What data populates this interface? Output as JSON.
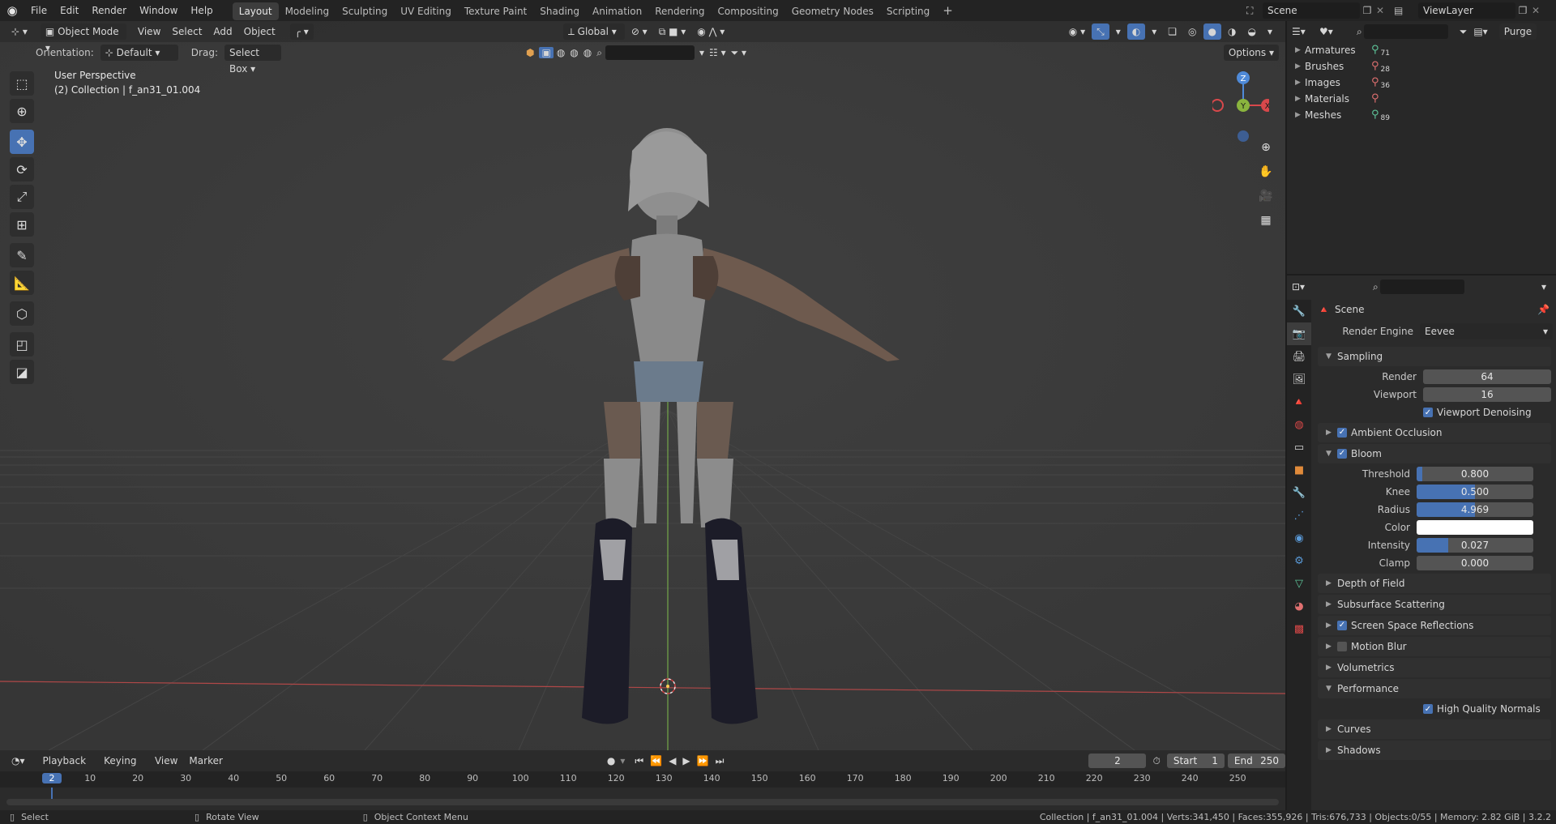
{
  "topbar": {
    "menus": [
      "File",
      "Edit",
      "Render",
      "Window",
      "Help"
    ],
    "workspaces": [
      "Layout",
      "Modeling",
      "Sculpting",
      "UV Editing",
      "Texture Paint",
      "Shading",
      "Animation",
      "Rendering",
      "Compositing",
      "Geometry Nodes",
      "Scripting"
    ],
    "active_workspace": "Layout",
    "add_tab": "+",
    "scene_name": "Scene",
    "view_layer": "ViewLayer"
  },
  "viewport": {
    "mode": "Object Mode",
    "menus": [
      "View",
      "Select",
      "Add",
      "Object"
    ],
    "transform_orientation": "Global",
    "orientation_label": "Orientation:",
    "orientation_value": "Default",
    "drag_label": "Drag:",
    "drag_value": "Select Box",
    "options_label": "Options",
    "perspective_text": "User Perspective",
    "collection_text": "(2) Collection | f_an31_01.004",
    "gizmo_labels": {
      "z": "Z",
      "y": "Y",
      "x": "X"
    }
  },
  "outliner": {
    "purge_label": "Purge",
    "items": [
      {
        "name": "Armatures",
        "count": "71",
        "color": "#5ec59a"
      },
      {
        "name": "Brushes",
        "count": "28",
        "color": "#e07070"
      },
      {
        "name": "Images",
        "count": "36",
        "color": "#e07070"
      },
      {
        "name": "Materials",
        "count": "",
        "color": "#e07070"
      },
      {
        "name": "Meshes",
        "count": "89",
        "color": "#5ec59a"
      }
    ]
  },
  "properties": {
    "context": "Scene",
    "render_engine_label": "Render Engine",
    "render_engine_value": "Eevee",
    "sampling": {
      "title": "Sampling",
      "render_label": "Render",
      "render_value": "64",
      "viewport_label": "Viewport",
      "viewport_value": "16",
      "denoise_label": "Viewport Denoising"
    },
    "ambient_occlusion": "Ambient Occlusion",
    "bloom": {
      "title": "Bloom",
      "threshold_label": "Threshold",
      "threshold_value": "0.800",
      "threshold_fill": 0.05,
      "knee_label": "Knee",
      "knee_value": "0.500",
      "knee_fill": 0.5,
      "radius_label": "Radius",
      "radius_value": "4.969",
      "radius_fill": 0.5,
      "color_label": "Color",
      "intensity_label": "Intensity",
      "intensity_value": "0.027",
      "intensity_fill": 0.27,
      "clamp_label": "Clamp",
      "clamp_value": "0.000",
      "clamp_fill": 0
    },
    "panels_after": [
      "Depth of Field",
      "Subsurface Scattering",
      "Screen Space Reflections",
      "Motion Blur",
      "Volumetrics"
    ],
    "performance": {
      "title": "Performance",
      "hq_normals": "High Quality Normals"
    },
    "panels_end": [
      "Curves",
      "Shadows"
    ]
  },
  "timeline": {
    "menus": [
      "Playback",
      "Keying",
      "View",
      "Marker"
    ],
    "current_frame": "2",
    "start_label": "Start",
    "start_value": "1",
    "end_label": "End",
    "end_value": "250",
    "ruler": [
      "2",
      "10",
      "20",
      "30",
      "40",
      "50",
      "60",
      "70",
      "80",
      "90",
      "100",
      "110",
      "120",
      "130",
      "140",
      "150",
      "160",
      "170",
      "180",
      "190",
      "200",
      "210",
      "220",
      "230",
      "240",
      "250"
    ]
  },
  "statusbar": {
    "select": "Select",
    "rotate": "Rotate View",
    "context_menu": "Object Context Menu",
    "stats": "Collection | f_an31_01.004 | Verts:341,450 | Faces:355,926 | Tris:676,733 | Objects:0/55 | Memory: 2.82 GiB | 3.2.2"
  }
}
